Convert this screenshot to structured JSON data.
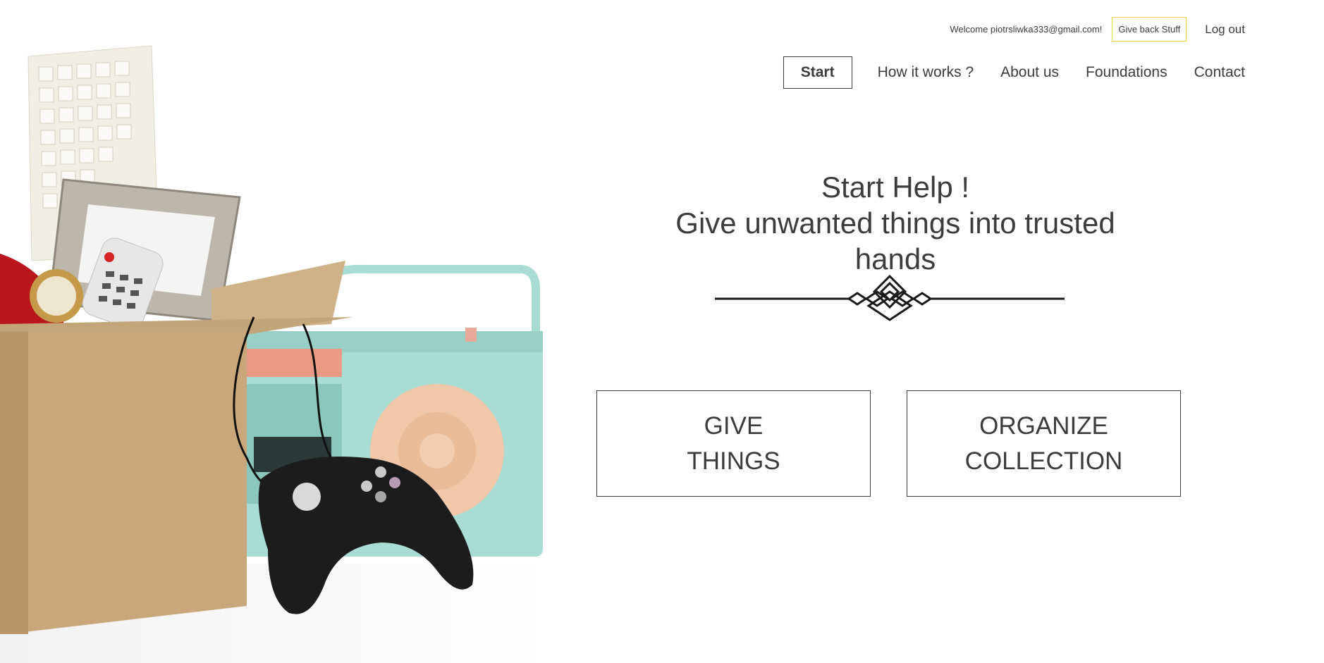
{
  "account": {
    "welcome_text": "Welcome piotrsliwka333@gmail.com!",
    "give_back_label": "Give back Stuff",
    "logout_label": "Log out"
  },
  "nav": {
    "items": [
      {
        "label": "Start",
        "active": true
      },
      {
        "label": "How it works ?"
      },
      {
        "label": "About us"
      },
      {
        "label": "Foundations"
      },
      {
        "label": "Contact"
      }
    ]
  },
  "hero": {
    "title": "Start Help !",
    "subtitle": "Give unwanted things into trusted hands",
    "image_icon": "donation-box-photo",
    "decoration_icon": "ornamental-divider-icon"
  },
  "cta": {
    "give_line1": "GIVE",
    "give_line2": "THINGS",
    "organize_line1": "ORGANIZE",
    "organize_line2": "COLLECTION"
  },
  "colors": {
    "text": "#3c3c3c",
    "accent_border": "#f2d14f",
    "box": "#c9a77a",
    "radio": "#a8dcd5",
    "speaker": "#f0c7a8"
  }
}
